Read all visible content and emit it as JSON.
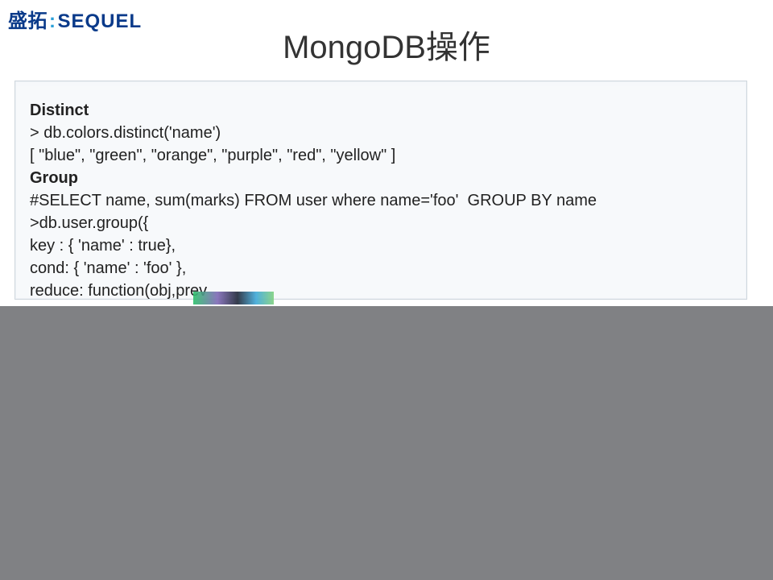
{
  "logo": {
    "cn": "盛拓",
    "colon": ":",
    "en": "SEQUEL"
  },
  "title": "MongoDB操作",
  "code": {
    "l1": "Distinct",
    "l2": "> db.colors.distinct('name')",
    "l3": "[ \"blue\", \"green\", \"orange\", \"purple\", \"red\", \"yellow\" ]",
    "l4": "Group",
    "l5": "#SELECT name, sum(marks) FROM user where name='foo'  GROUP BY name",
    "l6": ">db.user.group({",
    "l7": "key : { 'name' : true},",
    "l8": "cond: { 'name' : 'foo' },",
    "l9": "reduce: function(obj,prev"
  }
}
